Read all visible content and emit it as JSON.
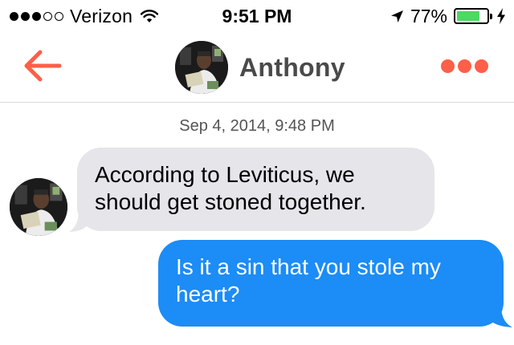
{
  "status_bar": {
    "carrier": "Verizon",
    "time": "9:51 PM",
    "battery_percent": "77%",
    "battery_level": 0.77,
    "signal_bars_filled": 3,
    "signal_bars_total": 5,
    "icons": [
      "wifi-icon",
      "location-arrow-icon",
      "battery-icon",
      "charging-bolt-icon"
    ]
  },
  "nav": {
    "contact_name": "Anthony",
    "back_icon": "arrow-left-icon",
    "more_icon": "ellipsis-icon",
    "accent_color": "#fd5f48"
  },
  "conversation": {
    "timestamp": "Sep 4, 2014, 9:48 PM",
    "messages": [
      {
        "direction": "incoming",
        "text": "According to Leviticus, we should get stoned together.",
        "bubble_color": "#e5e5ea"
      },
      {
        "direction": "outgoing",
        "text": "Is it a sin that you stole my heart?",
        "bubble_color": "#1c8cf6"
      }
    ]
  }
}
